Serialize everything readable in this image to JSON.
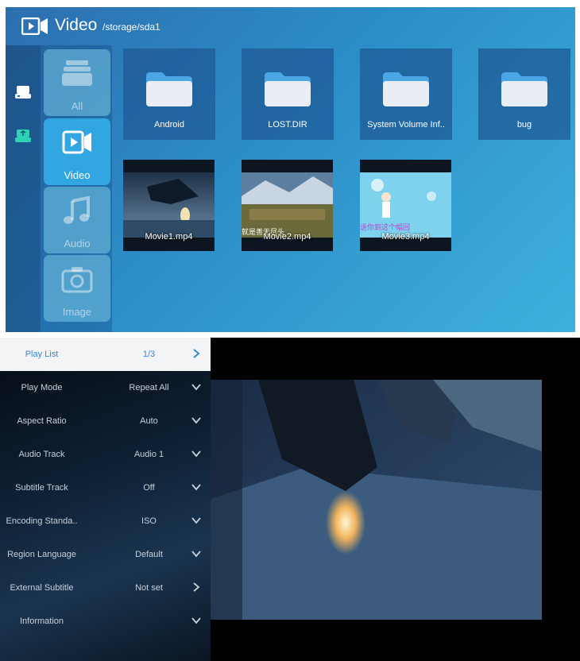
{
  "browser": {
    "title": "Video",
    "path": "/storage/sda1",
    "devices": [
      {
        "icon": "hard-drive-icon"
      },
      {
        "icon": "usb-drive-icon"
      }
    ],
    "categories": [
      {
        "label": "All",
        "icon": "folder-stack-icon",
        "active": false
      },
      {
        "label": "Video",
        "icon": "video-camera-icon",
        "active": true
      },
      {
        "label": "Audio",
        "icon": "music-note-icon",
        "active": false
      },
      {
        "label": "Image",
        "icon": "camera-icon",
        "active": false
      }
    ],
    "folders": [
      {
        "name": "Android"
      },
      {
        "name": "LOST.DIR"
      },
      {
        "name": "System Volume Inf.."
      },
      {
        "name": "bug"
      }
    ],
    "videos": [
      {
        "name": "Movie1.mp4"
      },
      {
        "name": "Movie2.mp4",
        "subtitle": "就是善无尽头"
      },
      {
        "name": "Movie3.mp4",
        "subtitle": "送你到这个幅回"
      }
    ]
  },
  "player_menu": {
    "items": [
      {
        "label": "Play List",
        "value": "1/3",
        "arrow": "chevron-right-icon",
        "selected": true
      },
      {
        "label": "Play Mode",
        "value": "Repeat All",
        "arrow": "chevron-down-icon",
        "selected": false
      },
      {
        "label": "Aspect Ratio",
        "value": "Auto",
        "arrow": "chevron-down-icon",
        "selected": false
      },
      {
        "label": "Audio Track",
        "value": "Audio 1",
        "arrow": "chevron-down-icon",
        "selected": false
      },
      {
        "label": "Subtitle Track",
        "value": "Off",
        "arrow": "chevron-down-icon",
        "selected": false
      },
      {
        "label": "Encoding Standa..",
        "value": "ISO",
        "arrow": "chevron-down-icon",
        "selected": false
      },
      {
        "label": "Region Language",
        "value": "Default",
        "arrow": "chevron-down-icon",
        "selected": false
      },
      {
        "label": "External Subtitle",
        "value": "Not set",
        "arrow": "chevron-right-icon",
        "selected": false
      },
      {
        "label": "Information",
        "value": "",
        "arrow": "chevron-down-icon",
        "selected": false
      }
    ]
  },
  "colors": {
    "accent": "#31a6e0",
    "selected_text": "#3a88cf",
    "folder_fill": "#e8eef4",
    "folder_tab": "#4aa6e6"
  }
}
